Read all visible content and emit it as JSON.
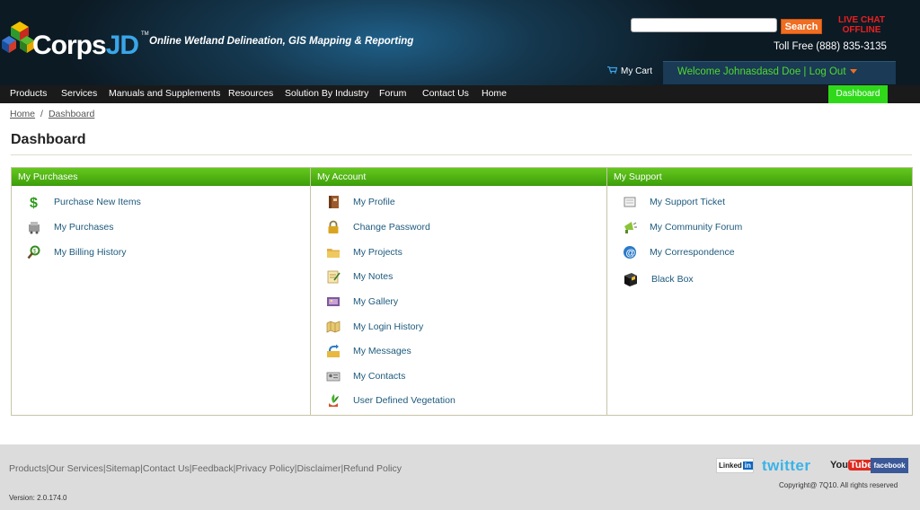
{
  "header": {
    "logo_main": "Corps",
    "logo_accent": "JD",
    "logo_tm": "TM",
    "tagline": "Online Wetland Delineation, GIS Mapping & Reporting",
    "search": {
      "value": "",
      "button_label": "Search"
    },
    "live_chat_line1": "LIVE CHAT",
    "live_chat_line2": "OFFLINE",
    "phone": "Toll Free (888) 835-3135",
    "cart_label": "My Cart",
    "welcome_text": "Welcome  Johnasdasd Doe | Log Out"
  },
  "nav": {
    "items": [
      "Products",
      "Services",
      "Manuals and Supplements",
      "Resources",
      "Solution By Industry",
      "Forum",
      "Contact Us",
      "Home"
    ],
    "dashboard_label": "Dashboard"
  },
  "breadcrumb": {
    "home": "Home",
    "separator": "/",
    "current": "Dashboard"
  },
  "page_title": "Dashboard",
  "panels": [
    {
      "title": "My Purchases",
      "items": [
        {
          "label": "Purchase New Items",
          "icon": "dollar-icon"
        },
        {
          "label": "My Purchases",
          "icon": "purchases-icon"
        },
        {
          "label": "My Billing History",
          "icon": "billing-history-icon"
        }
      ]
    },
    {
      "title": "My Account",
      "items": [
        {
          "label": "My Profile",
          "icon": "profile-book-icon"
        },
        {
          "label": "Change Password",
          "icon": "lock-icon"
        },
        {
          "label": "My Projects",
          "icon": "folder-icon"
        },
        {
          "label": "My Notes",
          "icon": "notes-icon"
        },
        {
          "label": "My Gallery",
          "icon": "gallery-icon"
        },
        {
          "label": "My Login History",
          "icon": "map-icon"
        },
        {
          "label": "My Messages",
          "icon": "messages-icon"
        },
        {
          "label": "My Contacts",
          "icon": "contacts-icon"
        },
        {
          "label": "User Defined Vegetation",
          "icon": "vegetation-icon"
        }
      ]
    },
    {
      "title": "My Support",
      "items": [
        {
          "label": "My Support Ticket",
          "icon": "ticket-icon"
        },
        {
          "label": "My Community Forum",
          "icon": "megaphone-icon"
        },
        {
          "label": "My Correspondence",
          "icon": "email-icon"
        },
        {
          "label": "Black Box",
          "icon": "black-box-icon"
        }
      ]
    }
  ],
  "footer": {
    "links": [
      "Products",
      "Our Services",
      "Sitemap",
      "Contact Us",
      "Feedback",
      "Privacy Policy",
      "Disclaimer",
      "Refund Policy"
    ],
    "version": "Version: 2.0.174.0",
    "copyright": "Copyright@ 7Q10. All rights reserved",
    "social": {
      "linkedin_text": "Linked",
      "linkedin_in": "in",
      "twitter": "twitter",
      "youtube_you": "You",
      "youtube_tube": "Tube",
      "facebook": "facebook"
    }
  },
  "colors": {
    "accent_green": "#3ea10a",
    "nav_active": "#2fd91a",
    "search_orange": "#ef6e22",
    "live_chat_red": "#e82020",
    "link_blue": "#1d5a7d"
  }
}
